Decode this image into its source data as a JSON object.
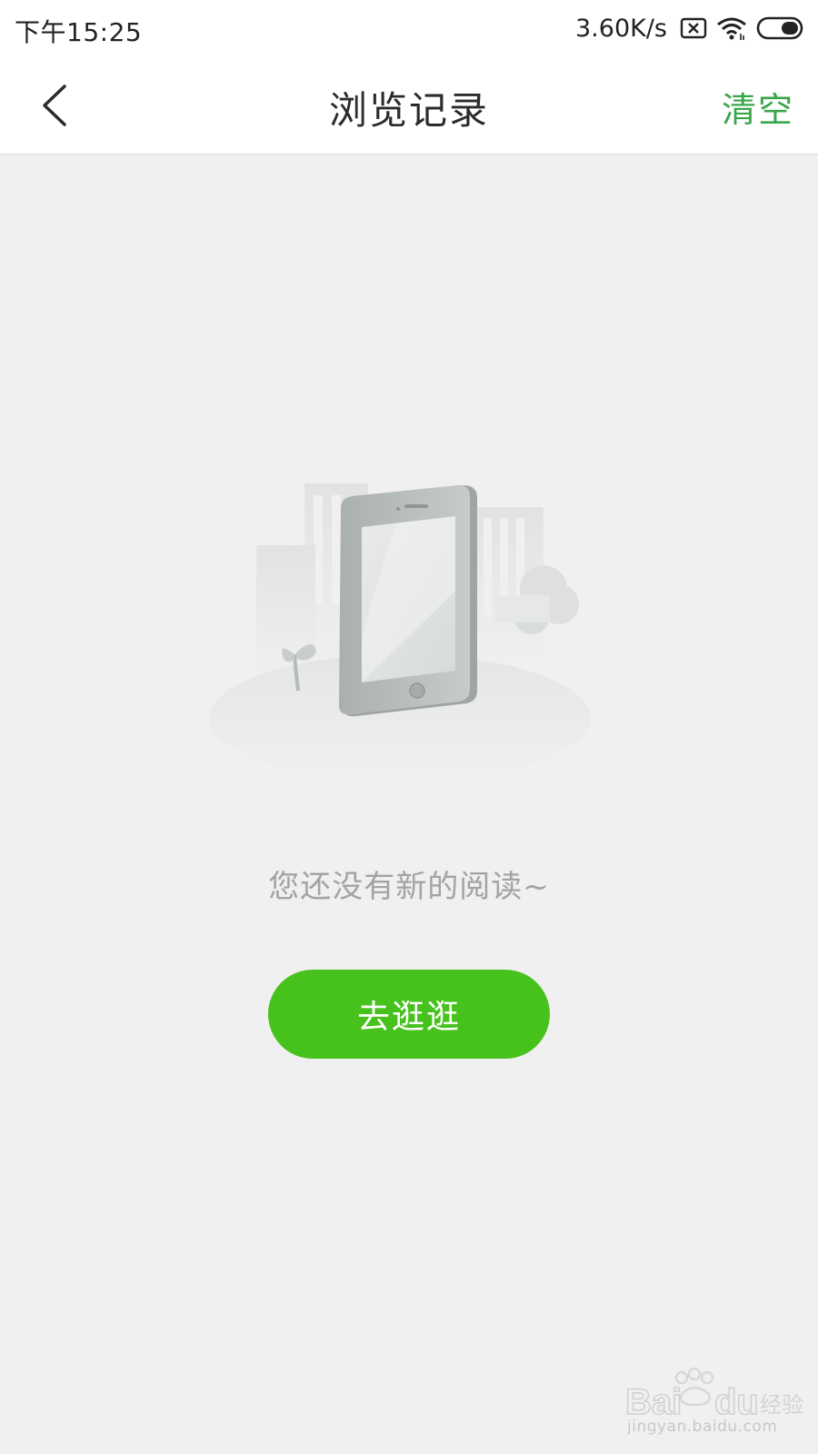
{
  "status_bar": {
    "time": "下午15:25",
    "network_speed": "3.60K/s",
    "icons": [
      "sim-error-icon",
      "wifi-icon",
      "battery-icon"
    ]
  },
  "nav": {
    "title": "浏览记录",
    "back_icon": "chevron-left-icon",
    "clear_label": "清空"
  },
  "empty_state": {
    "illustration": "tablet-empty-illustration",
    "message": "您还没有新的阅读~",
    "button_label": "去逛逛"
  },
  "watermark": {
    "brand": "Baidu经验",
    "url": "jingyan.baidu.com"
  },
  "colors": {
    "accent_green": "#47c21d",
    "clear_text": "#3aa64a",
    "page_background": "#f0f0f0",
    "message_text": "#a3a3a3"
  }
}
